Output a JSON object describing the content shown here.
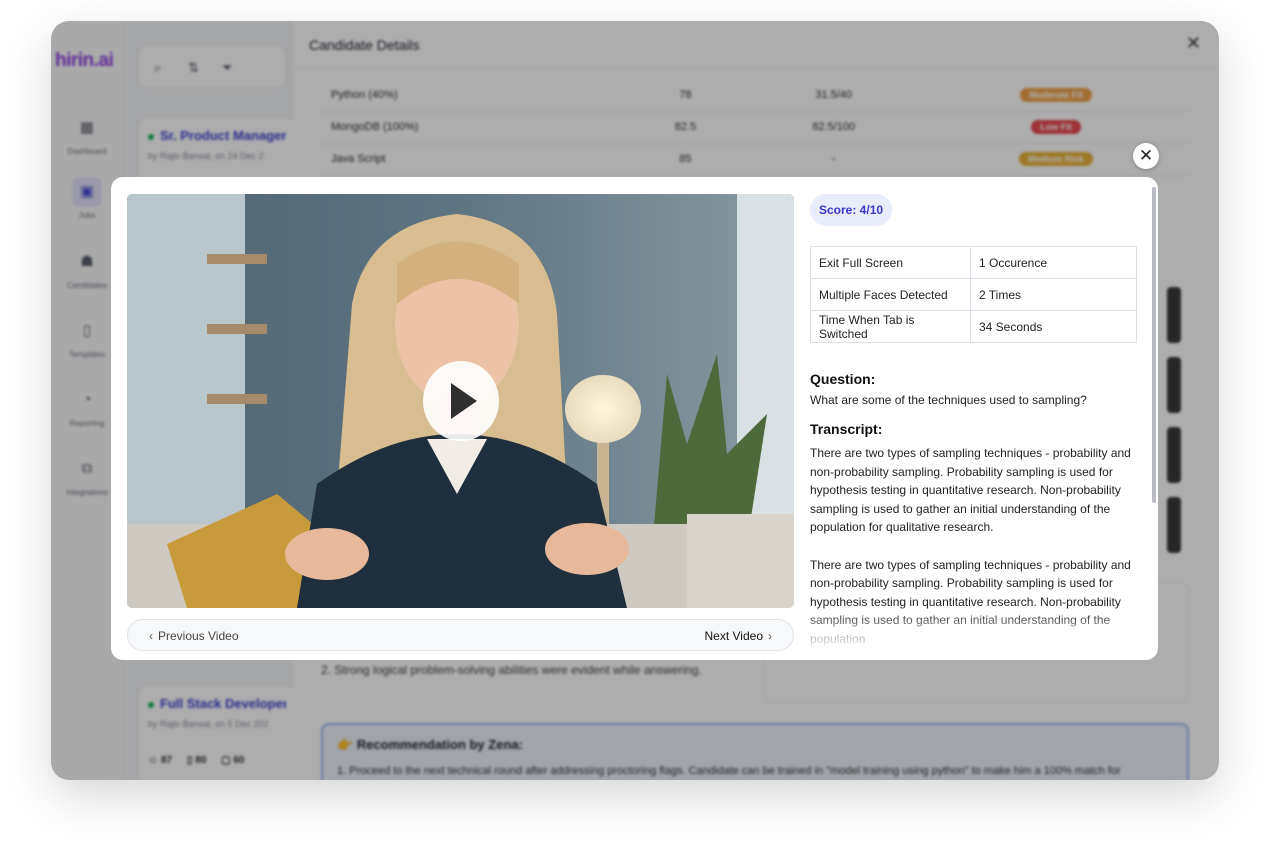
{
  "app": {
    "logo": "hirin.ai",
    "sidebar": [
      {
        "label": "Dashboard",
        "icon": "grid-icon"
      },
      {
        "label": "Jobs",
        "icon": "briefcase-icon"
      },
      {
        "label": "Candidates",
        "icon": "people-icon"
      },
      {
        "label": "Templates",
        "icon": "document-icon"
      },
      {
        "label": "Reporting",
        "icon": "chart-icon"
      },
      {
        "label": "Integrations",
        "icon": "plug-icon"
      }
    ],
    "jobs": [
      {
        "title": "Sr. Product Manager,",
        "meta": "by Rajiv Bansal, on 24 Dec 2"
      },
      {
        "title": "Full Stack Developer",
        "meta": "by Rajiv Bansal, on 5 Dec 202",
        "stats": [
          "87",
          "80",
          "60"
        ]
      }
    ],
    "details": {
      "title": "Candidate Details",
      "skills": [
        {
          "skill": "Python (40%)",
          "score": "78",
          "weighted": "31.5/40",
          "fit": "Moderate Fit",
          "fit_color": "#f0a24a"
        },
        {
          "skill": "MongoDB (100%)",
          "score": "82.5",
          "weighted": "82.5/100",
          "fit": "Low Fit",
          "fit_color": "#e84b55"
        },
        {
          "skill": "Java Script",
          "score": "85",
          "weighted": "-",
          "fit": "Medium Risk",
          "fit_color": "#e8b23a"
        }
      ],
      "bottom_point": "2. Strong logical problem-solving abilities were evident while answering.",
      "recommendation_title": "Recommendation by Zena:",
      "recommendation_text": "1. Proceed to the next technical round after addressing proctoring flags. Candidate can be trained in \"model training using python\" to make him a 100% match for"
    }
  },
  "modal": {
    "score": "Score: 4/10",
    "proctoring": [
      {
        "label": "Exit Full Screen",
        "value": "1 Occurence"
      },
      {
        "label": "Multiple Faces Detected",
        "value": "2 Times"
      },
      {
        "label": "Time When Tab is Switched",
        "value": "34 Seconds"
      }
    ],
    "question_label": "Question:",
    "question": "What are some of the techniques used to sampling?",
    "transcript_label": "Transcript:",
    "transcript": "There are two types of sampling techniques - probability and non-probability sampling. Probability sampling is used for hypothesis testing in quantitative research. Non-probability sampling is used to gather an initial understanding of the population for qualitative research.\n\nThere are two types of sampling techniques - probability and non-probability sampling. Probability sampling is used for hypothesis testing in quantitative research. Non-probability sampling is used to gather an initial understanding of the population",
    "prev_label": "Previous Video",
    "next_label": "Next Video"
  }
}
